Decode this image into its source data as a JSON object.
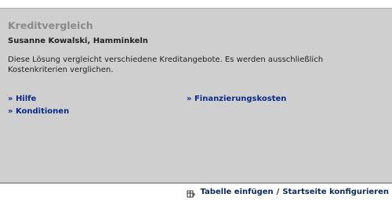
{
  "widget": {
    "title": "Kreditvergleich",
    "author": "Susanne Kowalski, Hamminkeln",
    "description": "Diese Lösung vergleicht verschiedene Kreditangebote. Es werden ausschließlich Kostenkriterien verglichen.",
    "links": {
      "help": "» Hilfe",
      "conditions": "» Konditionen",
      "financing_costs": "» Finanzierungskosten"
    }
  },
  "footer": {
    "icon": "table-settings-icon",
    "insert_table": "Tabelle einfügen",
    "separator": "/",
    "configure_start": "Startseite konfigurieren"
  }
}
